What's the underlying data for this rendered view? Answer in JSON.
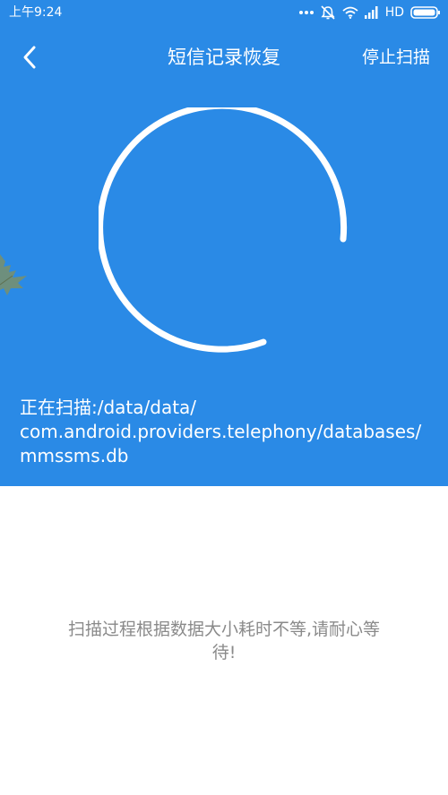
{
  "status_bar": {
    "time": "上午9:24",
    "icons": [
      "more-dots-icon",
      "alarm-off-icon",
      "wifi-icon",
      "signal-icon",
      "battery-icon"
    ],
    "network_label": "HD"
  },
  "header": {
    "title": "短信记录恢复",
    "back_icon": "chevron-left-icon",
    "stop_scan_label": "停止扫描"
  },
  "scan": {
    "status_lines": [
      "正在扫描:/data/data/",
      "com.android.providers.telephony/databases/",
      "mmssms.db"
    ]
  },
  "hint": {
    "line1": "扫描过程根据数据大小耗时不等,请耐心等",
    "line2": "待!"
  },
  "colors": {
    "panel_blue": "#2a8ae6",
    "text_white": "#ffffff",
    "hint_gray": "#8a8a8a",
    "leaf_green": "#7a8f6a"
  }
}
